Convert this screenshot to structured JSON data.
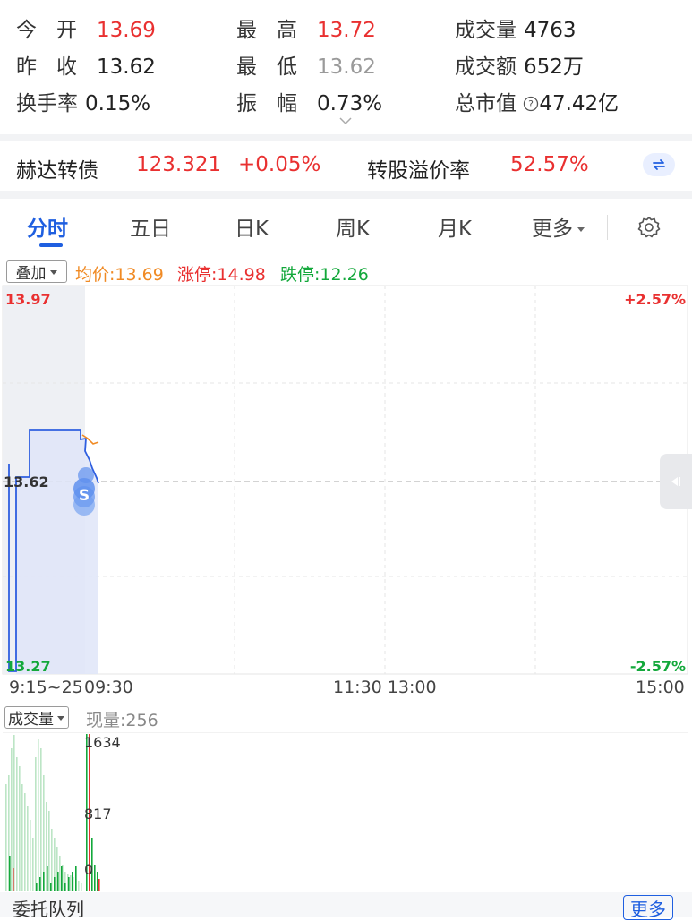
{
  "quote": {
    "open": {
      "label": "今开",
      "value": "13.69"
    },
    "high": {
      "label": "最高",
      "value": "13.72"
    },
    "volume": {
      "label": "成交量",
      "value": "4763"
    },
    "prev_close": {
      "label": "昨收",
      "value": "13.62"
    },
    "low": {
      "label": "最低",
      "value": "13.62"
    },
    "turnover_amount": {
      "label": "成交额",
      "value": "652万"
    },
    "turnover_rate": {
      "label": "换手率",
      "value": "0.15%"
    },
    "amplitude": {
      "label": "振幅",
      "value": "0.73%"
    },
    "market_cap": {
      "label": "总市值",
      "value": "47.42亿"
    }
  },
  "bond": {
    "name": "赫达转债",
    "price": "123.321",
    "change": "+0.05%",
    "premium_label": "转股溢价率",
    "premium_value": "52.57%"
  },
  "tabs": [
    {
      "label": "分时",
      "active": true
    },
    {
      "label": "五日",
      "active": false
    },
    {
      "label": "日K",
      "active": false
    },
    {
      "label": "周K",
      "active": false
    },
    {
      "label": "月K",
      "active": false
    },
    {
      "label": "更多",
      "active": false
    }
  ],
  "overlay": {
    "label": "叠加"
  },
  "legend": {
    "avg": "均价:13.69",
    "limit_up": "涨停:14.98",
    "limit_down": "跌停:12.26"
  },
  "price_axis": {
    "top": "13.97",
    "mid": "13.62",
    "bottom": "13.27",
    "pct_top": "+2.57%",
    "pct_bottom": "-2.57%"
  },
  "time_axis": {
    "auction": "9:15~25",
    "open": "09:30",
    "midday": "11:30 13:00",
    "close": "15:00"
  },
  "volume_panel": {
    "selector": "成交量",
    "current": "现量:256",
    "max": "1634",
    "mid": "817",
    "zero": "0"
  },
  "bottom": {
    "queue": "委托队列",
    "more": "更多"
  },
  "markers": {
    "s_label": "S"
  },
  "colors": {
    "up": "#e93030",
    "down": "#13a83b",
    "avg": "#f08a24",
    "line": "#2f5fe0",
    "accent": "#1f5fe0"
  }
}
